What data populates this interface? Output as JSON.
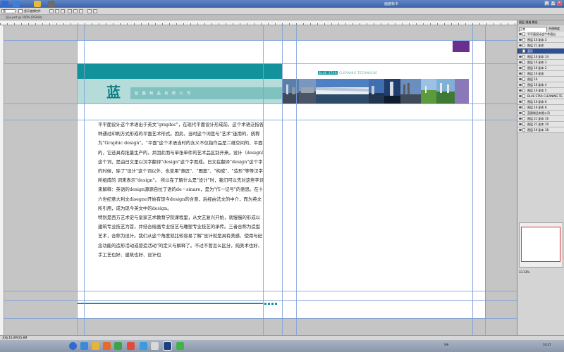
{
  "window": {
    "title": "画面标卡",
    "min": "_",
    "max": "□",
    "close": "×"
  },
  "options": {
    "select_value": "组",
    "checkbox_label": "显示变换控件"
  },
  "doc_tab": {
    "label": "设计.psd @ 100% (RGB/8)"
  },
  "page": {
    "logo_char": "蓝",
    "company": "蓝 图 制 品 有 限 公 司",
    "tagline_highlight": "BLUE STAR",
    "tagline_rest": "CLEANING TECHNIQUE",
    "paragraphs": [
      "平平面设计这个术语出于英文\"graphic\"，在现代平面设计形成前，这个术语泛指各种通过印刷方式形成的平面艺术形式。因此，当时这个词是与\"艺术\"连用的，统称为\"Graphic design\"。\"平面\"这个术语当时的含义不仅指作品是二维空间的、平面的，它还具有批量生产的，并因此而与单张单件的艺术品区别开来。设计（design）这个词，是由日文里以汉字翻译\"design\"这个字而成。日文在翻译\"design\"这个字的时候，除了\"设计\"这个词以外，也曾用\"意匠\"、\"图案\"、\"构成\"、\"造形\"等等汉字所组成的 词来表示\"design\"。 所以在了解什么是\"设计\"时，我们可以先对这些字词来解释：英语的design源源自拉丁语的de－sinare，是为\"作一记号\"的意思。在十六世纪意大利文disegno开始有现今design的含意，后经由法文的中介，而为英文所引用，成为现今英文中的design。",
      "特别是西方艺术史与皇家艺术教育学院课程里，从文艺复兴开始，就慢慢的形成以建筑专业技艺为首，并结合绘画专业技艺与雕塑专业技艺的承传。三者合称为造型艺术，合称为设计。我们从这个角度就比较容易了解\"设计就是具有美感、使用与纪念功能的造形活动或营造活动\"的定义与解释了。不过不管怎么区分，纯美术也好、手工艺也好、建筑也好、设计也"
    ]
  },
  "layers_panel": {
    "tabs": "图层 通道 路径",
    "blend_mode": "正常",
    "opacity_label": "不透明度",
    "rows": [
      {
        "label": "平平面设计这个术语出",
        "type": "text"
      },
      {
        "label": "图层 16 副本 3",
        "type": "img"
      },
      {
        "label": "图层 21 副本",
        "type": "img"
      },
      {
        "label": "蓝形",
        "type": "img",
        "selected": true
      },
      {
        "label": "图层 16 副本 14",
        "type": "img"
      },
      {
        "label": "图层 16 副本 3",
        "type": "img"
      },
      {
        "label": "图层 16 副本 2",
        "type": "img"
      },
      {
        "label": "图层 16 副本",
        "type": "img"
      },
      {
        "label": "图层 16",
        "type": "img"
      },
      {
        "label": "图层 16 副本 4",
        "type": "img"
      },
      {
        "label": "图层 16 副本 5",
        "type": "img"
      },
      {
        "label": "BLUE STAR CLEANING TE",
        "type": "text"
      },
      {
        "label": "图层 16 副本 6",
        "type": "img"
      },
      {
        "label": "图层 16 副本 8",
        "type": "img"
      },
      {
        "label": "蓝图制品有限公司",
        "type": "text"
      },
      {
        "label": "图层 21 副本 16",
        "type": "img"
      },
      {
        "label": "图层 21 副本 19",
        "type": "img"
      },
      {
        "label": "图层 16 副本 18",
        "type": "img"
      }
    ],
    "zoom": "33.33%"
  },
  "status": {
    "text": "文档:16.0M/35.8M"
  },
  "tray": {
    "ime": "S中",
    "time": "10:27"
  },
  "colors": {
    "teal": "#12939b",
    "light_teal": "#b6dcd9",
    "purple": "#6a2e8e"
  }
}
